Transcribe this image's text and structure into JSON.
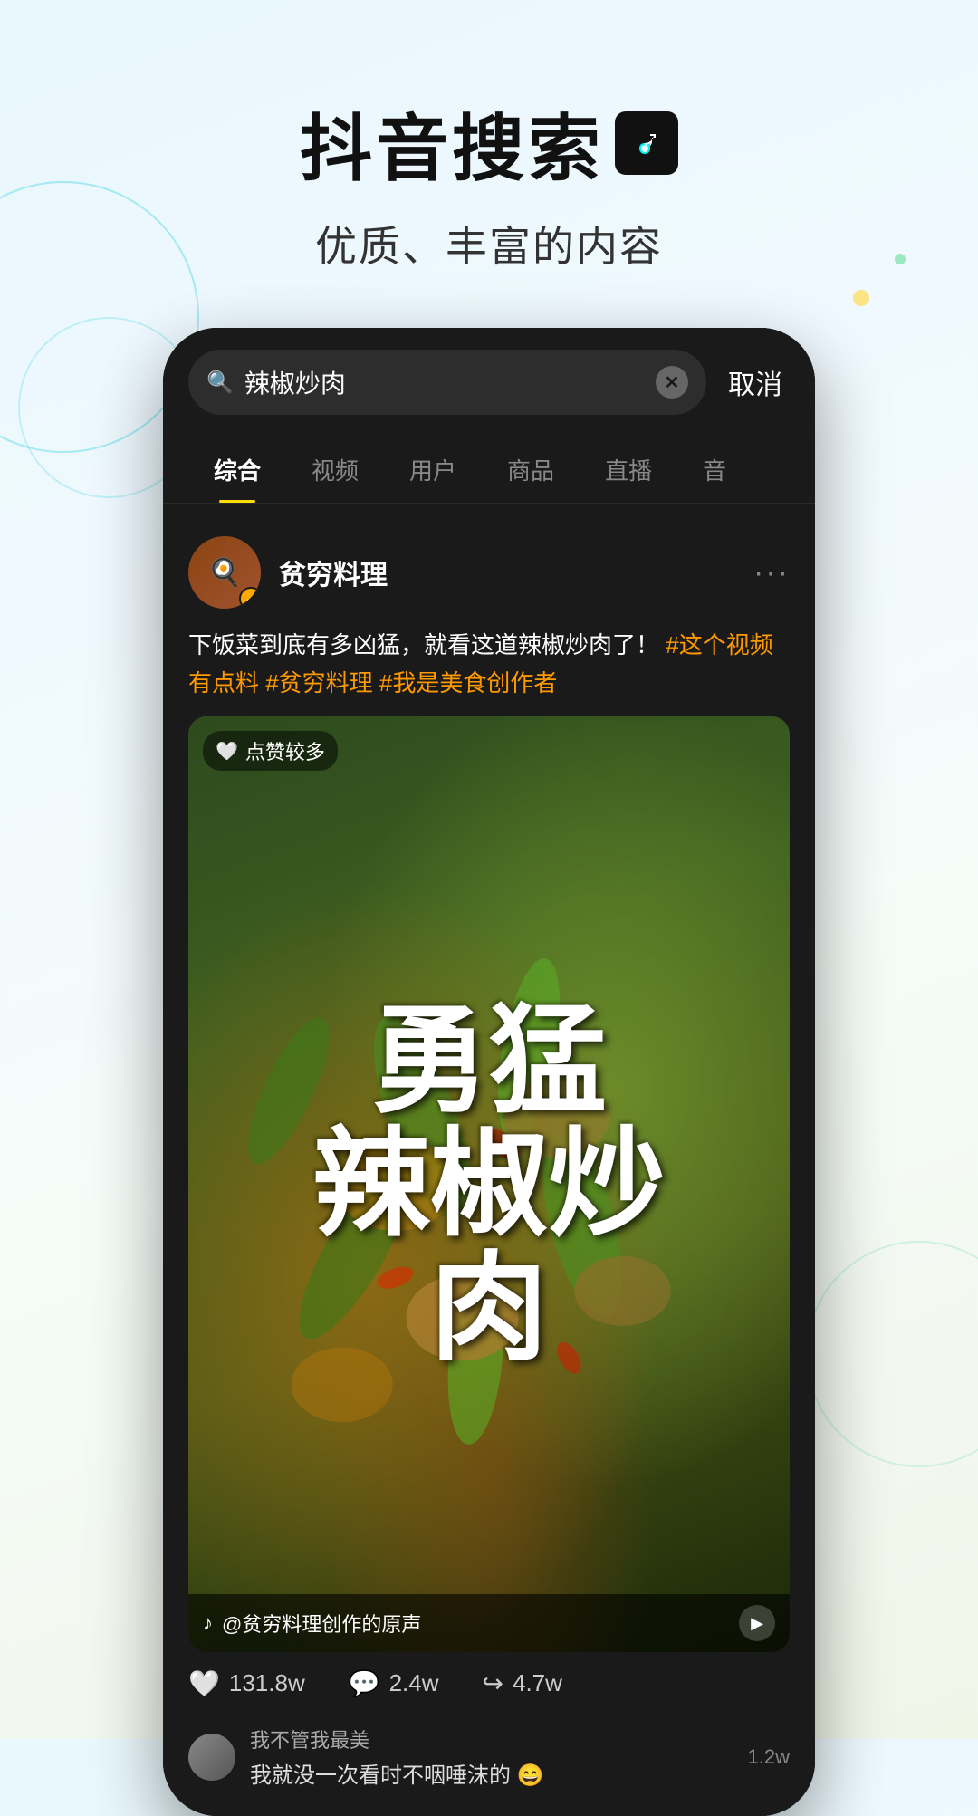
{
  "header": {
    "title": "抖音搜索",
    "tiktok_icon": "♪",
    "subtitle": "优质、丰富的内容"
  },
  "phone": {
    "search": {
      "query": "辣椒炒肉",
      "cancel_label": "取消"
    },
    "tabs": [
      {
        "id": "comprehensive",
        "label": "综合",
        "active": true
      },
      {
        "id": "video",
        "label": "视频",
        "active": false
      },
      {
        "id": "user",
        "label": "用户",
        "active": false
      },
      {
        "id": "product",
        "label": "商品",
        "active": false
      },
      {
        "id": "live",
        "label": "直播",
        "active": false
      },
      {
        "id": "audio",
        "label": "音",
        "active": false
      }
    ],
    "post": {
      "user": {
        "name": "贫穷料理",
        "verified": true
      },
      "description": "下饭菜到底有多凶猛，就看这道辣椒炒肉了！",
      "hashtags": [
        "#这个视频有点料",
        "#贫穷料理",
        "#我是美食创作者"
      ],
      "video": {
        "likes_badge": "点赞较多",
        "big_text": "勇猛辣椒炒肉",
        "sound_info": "@贫穷料理创作的原声"
      },
      "stats": {
        "likes": "131.8w",
        "comments": "2.4w",
        "shares": "4.7w"
      },
      "comments": [
        {
          "author": "我不管我最美",
          "text": "我就没一次看时不咽唾沫的 😄",
          "count": "1.2w"
        }
      ]
    }
  }
}
